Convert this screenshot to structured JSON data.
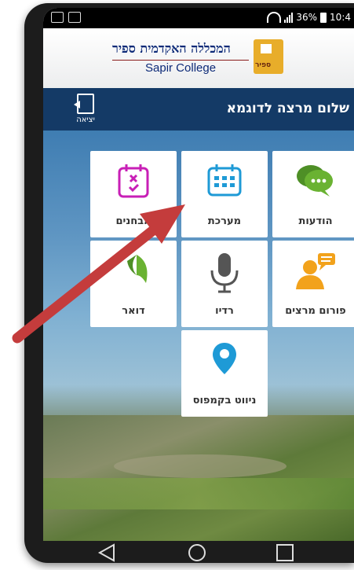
{
  "status_bar": {
    "battery": "36%",
    "time": "10:4"
  },
  "logo": {
    "name_he": "המכללה האקדמית ספיר",
    "name_en": "Sapir College",
    "mark_text": "ספיר"
  },
  "header": {
    "greeting": "שלום מרצה לדוגמא",
    "exit_label": "יציאה"
  },
  "tiles": [
    {
      "label": "הודעות",
      "icon": "chat-bubbles-icon"
    },
    {
      "label": "מערכת",
      "icon": "calendar-icon"
    },
    {
      "label": "מבחנים",
      "icon": "exam-calendar-icon"
    },
    {
      "label": "פורום מרצים",
      "icon": "forum-icon"
    },
    {
      "label": "רדיו",
      "icon": "microphone-icon"
    },
    {
      "label": "דואר",
      "icon": "mail-icon"
    },
    {
      "label": "ניווט בקמפוס",
      "icon": "map-pin-icon"
    }
  ],
  "colors": {
    "header": "#143a66",
    "accent_blue": "#1e9ad6",
    "green": "#6ab232",
    "orange": "#f2a21b",
    "magenta": "#c81fb6",
    "arrow": "#c43c3c"
  },
  "nav": [
    "back-icon",
    "home-icon",
    "recents-icon"
  ]
}
